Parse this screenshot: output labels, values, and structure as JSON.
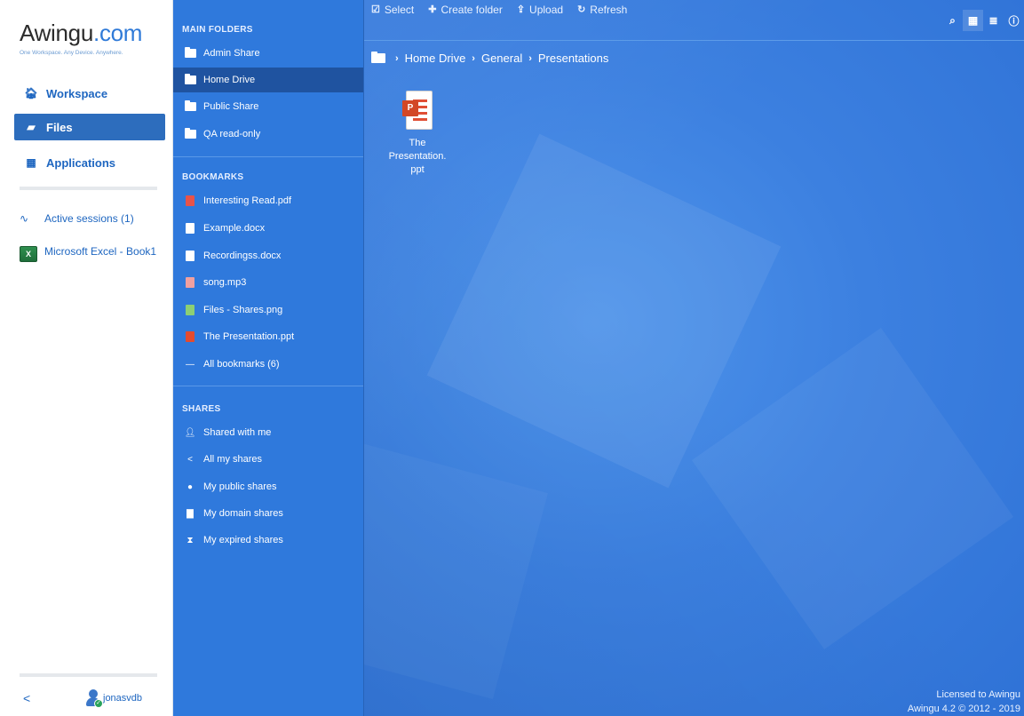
{
  "brand": {
    "name_prefix": "Awingu",
    "name_suffix": ".com",
    "tagline": "One Workspace. Any Device. Anywhere."
  },
  "nav": {
    "items": [
      {
        "label": "Workspace",
        "icon": "home-icon"
      },
      {
        "label": "Files",
        "icon": "folder-open-icon"
      },
      {
        "label": "Applications",
        "icon": "grid-icon"
      }
    ],
    "active_sessions": "Active sessions (1)",
    "session_app": "Microsoft Excel - Book1",
    "back": "<",
    "user": "jonasvdb"
  },
  "folders": {
    "main_title": "MAIN FOLDERS",
    "main": [
      "Admin Share",
      "Home Drive",
      "Public Share",
      "QA read-only"
    ],
    "bookmarks_title": "BOOKMARKS",
    "bookmarks": [
      "Interesting Read.pdf",
      "Example.docx",
      "Recordingss.docx",
      "song.mp3",
      "Files - Shares.png",
      "The Presentation.ppt",
      "All bookmarks (6)"
    ],
    "shares_title": "SHARES",
    "shares": [
      "Shared with me",
      "All my shares",
      "My public shares",
      "My domain shares",
      "My expired shares"
    ]
  },
  "toolbar": {
    "select": "Select",
    "create_folder": "Create folder",
    "upload": "Upload",
    "refresh": "Refresh"
  },
  "breadcrumb": [
    "Home Drive",
    "General",
    "Presentations"
  ],
  "files": [
    {
      "name": "The Presentation.ppt",
      "line1": "The",
      "line2": "Presentation.",
      "line3": "ppt"
    }
  ],
  "footer": {
    "license": "Licensed to Awingu",
    "version": "Awingu 4.2 © 2012 - 2019"
  },
  "colors": {
    "accent": "#2f79dc",
    "active_folder": "#1f53a0",
    "nav_active": "#2d6dbd"
  }
}
